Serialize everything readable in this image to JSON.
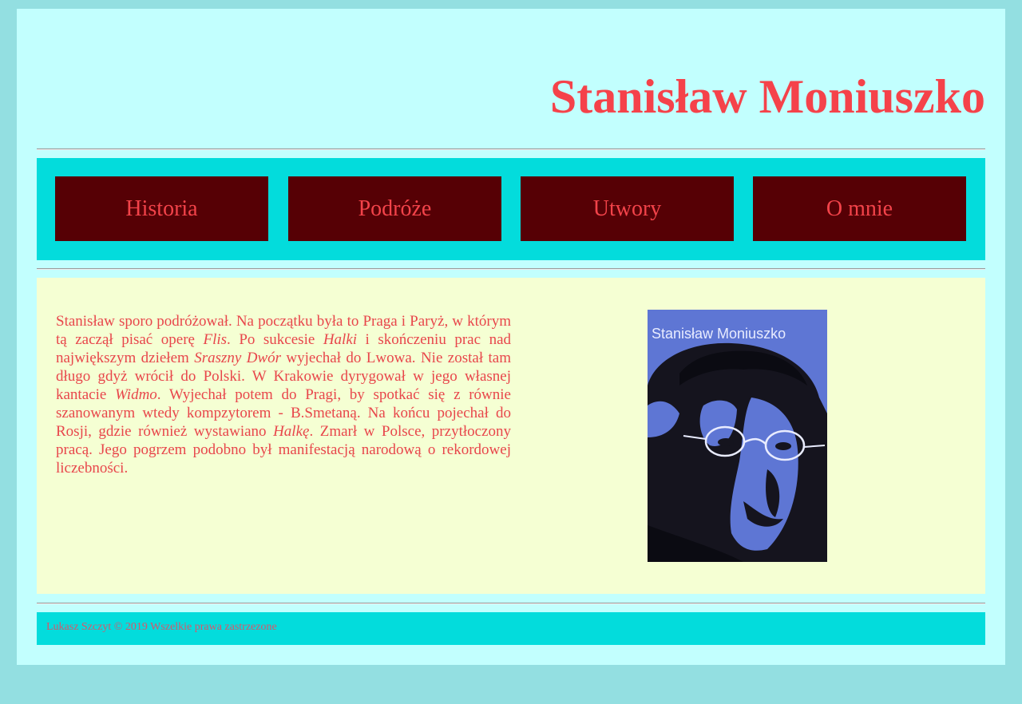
{
  "header": {
    "title": "Stanisław Moniuszko"
  },
  "nav": {
    "items": [
      {
        "label": "Historia"
      },
      {
        "label": "Podróże"
      },
      {
        "label": "Utwory"
      },
      {
        "label": "O mnie"
      }
    ]
  },
  "main": {
    "paragraph": [
      {
        "text": "Stanisław sporo podróżował. Na początku była to Praga i Paryż, w którym tą zaczął pisać operę ",
        "italic": false
      },
      {
        "text": "Flis",
        "italic": true
      },
      {
        "text": ". Po sukcesie ",
        "italic": false
      },
      {
        "text": "Halki",
        "italic": true
      },
      {
        "text": " i skończeniu prac nad największym dziełem ",
        "italic": false
      },
      {
        "text": "Sraszny Dwór",
        "italic": true
      },
      {
        "text": " wyjechał do Lwowa. Nie został tam długo gdyż wrócił do Polski. W Krakowie dyrygował w jego własnej kantacie ",
        "italic": false
      },
      {
        "text": "Widmo",
        "italic": true
      },
      {
        "text": ". Wyjechał potem do Pragi, by spotkać się z równie szanowanym wtedy kompzytorem - B.Smetaną. Na końcu pojechał do Rosji, gdzie również wystawiano ",
        "italic": false
      },
      {
        "text": "Halkę",
        "italic": true
      },
      {
        "text": ". Zmarł w Polsce, przytłoczony pracą. Jego pogrzem podobno był manifestacją narodową o rekordowej liczebności.",
        "italic": false
      }
    ],
    "image": {
      "caption": "Stanisław Moniuszko"
    }
  },
  "footer": {
    "text": "Lukasz Szczyt © 2019 Wszelkie prawa zastrzezone"
  },
  "colors": {
    "background": "#93dfe1",
    "page": "#c2fffe",
    "accent_text": "#f5424a",
    "nav_bar": "#03dcdc",
    "nav_button": "#560005",
    "content_bg": "#f5ffd3",
    "portrait_blue": "#5e76d4"
  }
}
